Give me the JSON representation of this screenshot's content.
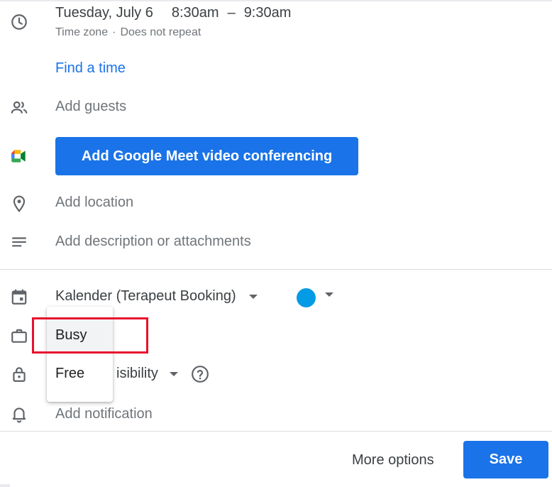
{
  "event": {
    "date": "Tuesday, July 6",
    "start_time": "8:30am",
    "dash": "–",
    "end_time": "9:30am",
    "timezone_label": "Time zone",
    "separator": "·",
    "repeat_label": "Does not repeat",
    "find_time": "Find a time"
  },
  "guests": {
    "placeholder": "Add guests"
  },
  "meet": {
    "button_label": "Add Google Meet video conferencing"
  },
  "location": {
    "placeholder": "Add location"
  },
  "description": {
    "placeholder": "Add description or attachments"
  },
  "calendar": {
    "name": "Kalender (Terapeut Booking)",
    "color": "#039be5"
  },
  "availability_menu": {
    "options": [
      "Busy",
      "Free"
    ],
    "selected": "Busy"
  },
  "visibility": {
    "label_partial": "isibility"
  },
  "notification": {
    "placeholder": "Add notification"
  },
  "footer": {
    "more_options": "More options",
    "save": "Save"
  },
  "colors": {
    "accent": "#1a73e8",
    "highlight": "#e8112d"
  }
}
